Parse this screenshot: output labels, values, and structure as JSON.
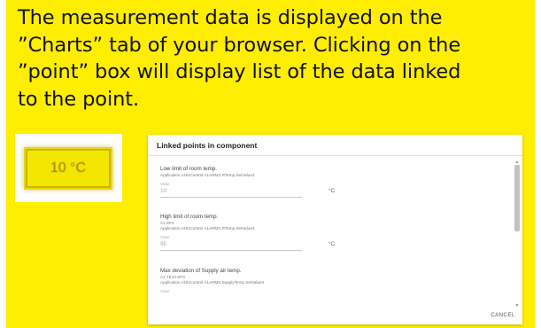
{
  "instructions": {
    "lines": [
      "The measurement data is displayed on the",
      "”Charts” tab of your browser. Clicking on the",
      "”point”  box will display  list of the data linked",
      "to the point."
    ]
  },
  "thumbnail": {
    "temperature_text": "10 °C"
  },
  "dialog": {
    "title": "Linked points in component",
    "points": [
      {
        "title": "Low limit of room temp.",
        "sub1": "Application.AHUControl.ALARMS.RTemp.SetValue3",
        "label": "Value",
        "value": "10",
        "unit": "°C"
      },
      {
        "title": "High limit of room temp.",
        "sub1": "A1.SP2",
        "sub2": "Application.AHUControl.ALARMS.RTemp.SetValue4",
        "label": "Value",
        "value": "95",
        "unit": "°C"
      },
      {
        "title": "Max deviation of Supply air temp.",
        "sub1": "A1.TE10.SP3",
        "sub2": "Application.AHUControl.ALARMS.SupplyTemp.SetValue3",
        "label": "Value"
      }
    ],
    "scroll": {
      "up_arrow": "▲",
      "down_arrow": "▼"
    },
    "cancel_label": "CANCEL"
  }
}
